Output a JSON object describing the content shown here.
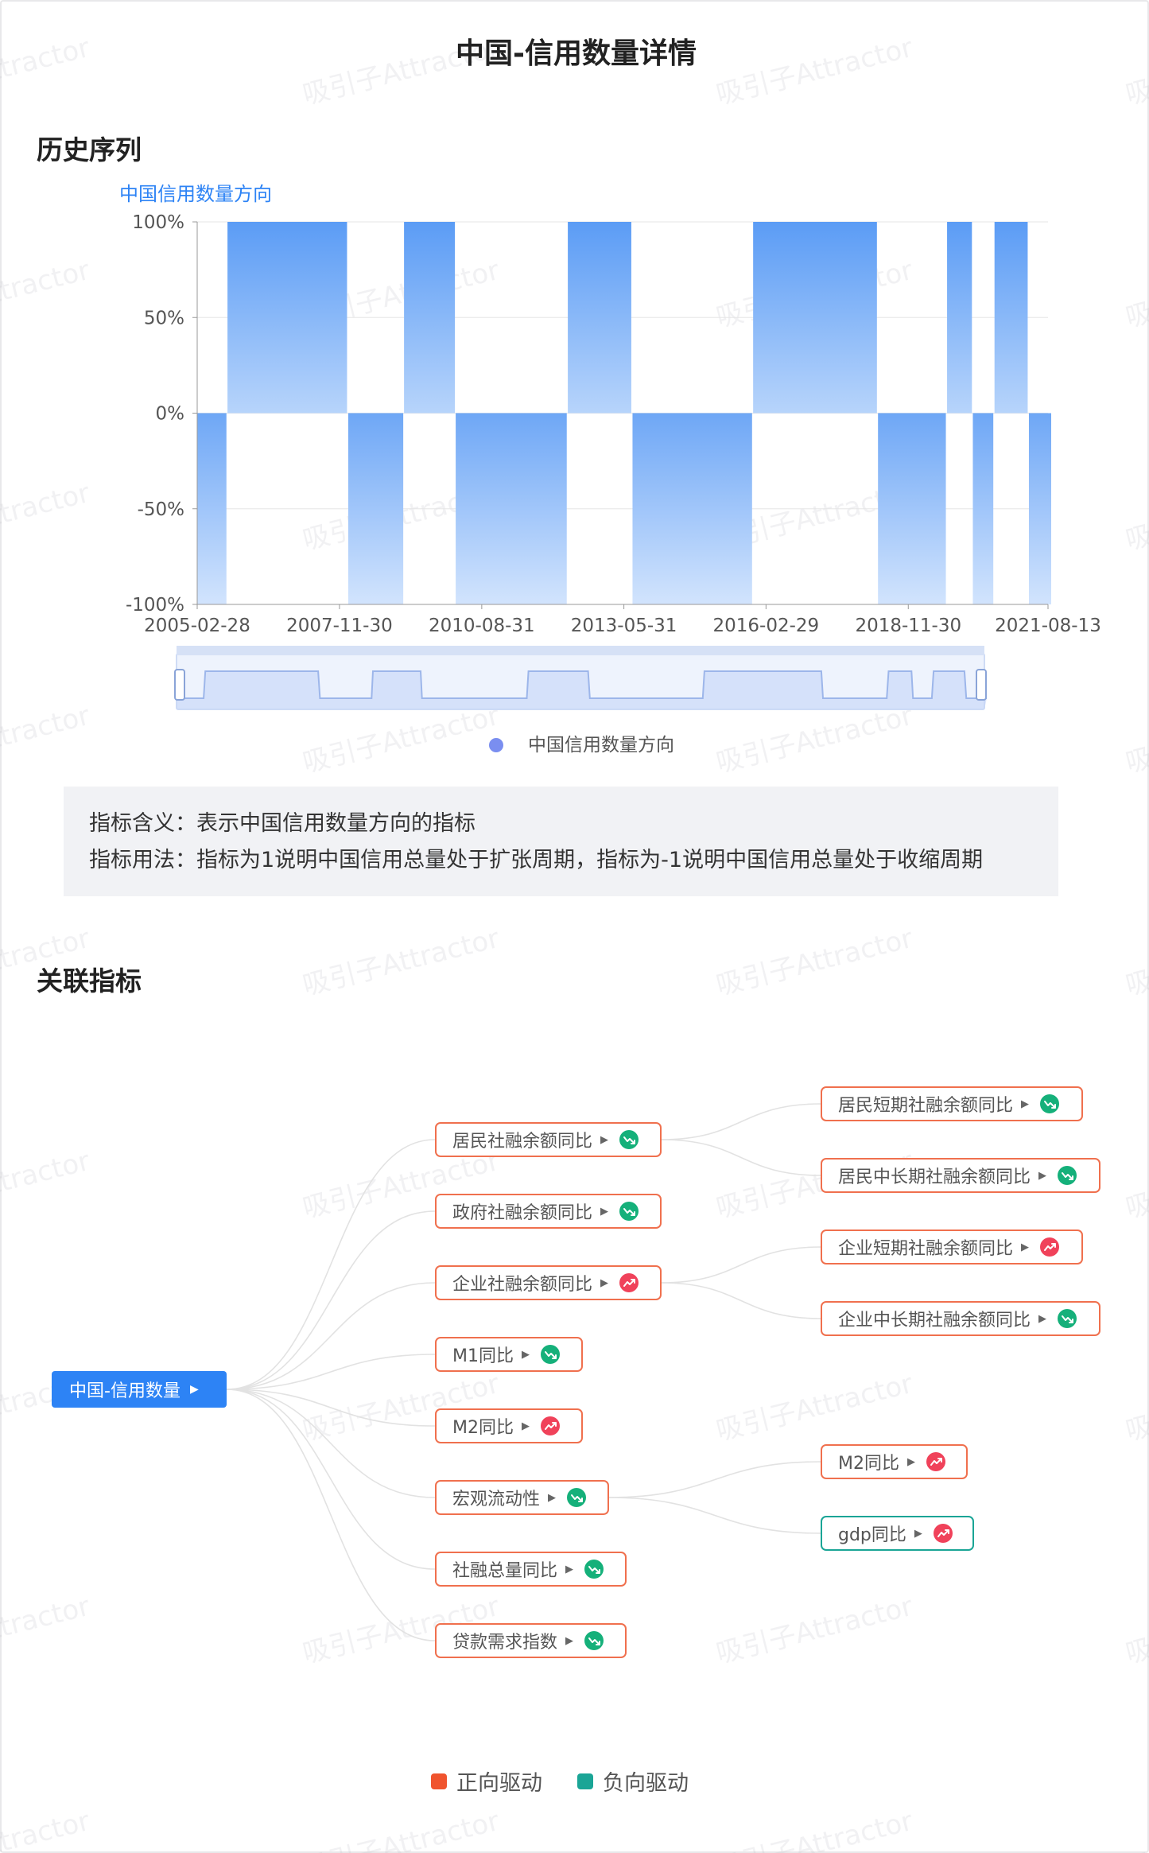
{
  "header": {
    "title": "中国-信用数量详情"
  },
  "sections": {
    "history": "历史序列",
    "related": "关联指标"
  },
  "chart": {
    "legend_label": "中国信用数量方向",
    "accent_color": "#5b9cf5",
    "slider_dot_color": "#7a8ef0"
  },
  "chart_data": {
    "type": "bar",
    "title": "中国信用数量方向",
    "ylim": [
      -100,
      100
    ],
    "y_ticks": [
      "100%",
      "50%",
      "0%",
      "-50%",
      "-100%"
    ],
    "x_ticks": [
      "2005-02-28",
      "2007-11-30",
      "2010-08-31",
      "2013-05-31",
      "2016-02-29",
      "2018-11-30",
      "2021-08-13"
    ],
    "x_range": [
      "2005-02-28",
      "2021-08-13"
    ],
    "grid": true,
    "legend_position": "bottom",
    "series": [
      {
        "name": "中国信用数量方向",
        "segments": [
          {
            "start": "2005-02-28",
            "end": "2005-08-31",
            "value": -100
          },
          {
            "start": "2005-09-30",
            "end": "2007-12-31",
            "value": 100
          },
          {
            "start": "2008-01-31",
            "end": "2009-01-31",
            "value": -100
          },
          {
            "start": "2009-02-28",
            "end": "2010-01-31",
            "value": 100
          },
          {
            "start": "2010-02-28",
            "end": "2012-03-31",
            "value": -100
          },
          {
            "start": "2012-04-30",
            "end": "2013-06-30",
            "value": 100
          },
          {
            "start": "2013-07-31",
            "end": "2015-10-31",
            "value": -100
          },
          {
            "start": "2015-11-30",
            "end": "2018-03-31",
            "value": 100
          },
          {
            "start": "2018-04-30",
            "end": "2019-07-31",
            "value": -100
          },
          {
            "start": "2019-08-31",
            "end": "2020-01-31",
            "value": 100
          },
          {
            "start": "2020-02-29",
            "end": "2020-06-30",
            "value": -100
          },
          {
            "start": "2020-07-31",
            "end": "2021-02-28",
            "value": 100
          },
          {
            "start": "2021-03-31",
            "end": "2021-08-13",
            "value": -100
          }
        ]
      }
    ]
  },
  "description": {
    "line1": "指标含义：表示中国信用数量方向的指标",
    "line2": "指标用法：指标为1说明中国信用总量处于扩张周期，指标为-1说明中国信用总量处于收缩周期"
  },
  "graph": {
    "root": "中国-信用数量",
    "level1": [
      {
        "label": "居民社融余额同比",
        "driver": "positive",
        "trend": "down"
      },
      {
        "label": "政府社融余额同比",
        "driver": "positive",
        "trend": "down"
      },
      {
        "label": "企业社融余额同比",
        "driver": "positive",
        "trend": "up"
      },
      {
        "label": "M1同比",
        "driver": "positive",
        "trend": "down"
      },
      {
        "label": "M2同比",
        "driver": "positive",
        "trend": "up"
      },
      {
        "label": "宏观流动性",
        "driver": "positive",
        "trend": "down"
      },
      {
        "label": "社融总量同比",
        "driver": "positive",
        "trend": "down"
      },
      {
        "label": "贷款需求指数",
        "driver": "positive",
        "trend": "down"
      }
    ],
    "level2": [
      {
        "label": "居民短期社融余额同比",
        "driver": "positive",
        "trend": "down",
        "parent": 0
      },
      {
        "label": "居民中长期社融余额同比",
        "driver": "positive",
        "trend": "down",
        "parent": 0
      },
      {
        "label": "企业短期社融余额同比",
        "driver": "positive",
        "trend": "up",
        "parent": 2
      },
      {
        "label": "企业中长期社融余额同比",
        "driver": "positive",
        "trend": "down",
        "parent": 2
      },
      {
        "label": "M2同比",
        "driver": "positive",
        "trend": "up",
        "parent": 5
      },
      {
        "label": "gdp同比",
        "driver": "negative",
        "trend": "up",
        "parent": 5
      }
    ],
    "icons": {
      "arrow": "caret-right-icon",
      "down": "trend-down-icon",
      "up": "trend-up-icon"
    },
    "colors": {
      "positive": "#f0704e",
      "negative": "#1aa596",
      "trend_down": "#15b07a",
      "trend_up": "#f0425a",
      "root": "#2d83f5"
    }
  },
  "legend": {
    "positive": "正向驱动",
    "negative": "负向驱动"
  },
  "watermark": "吸引子Attractor"
}
